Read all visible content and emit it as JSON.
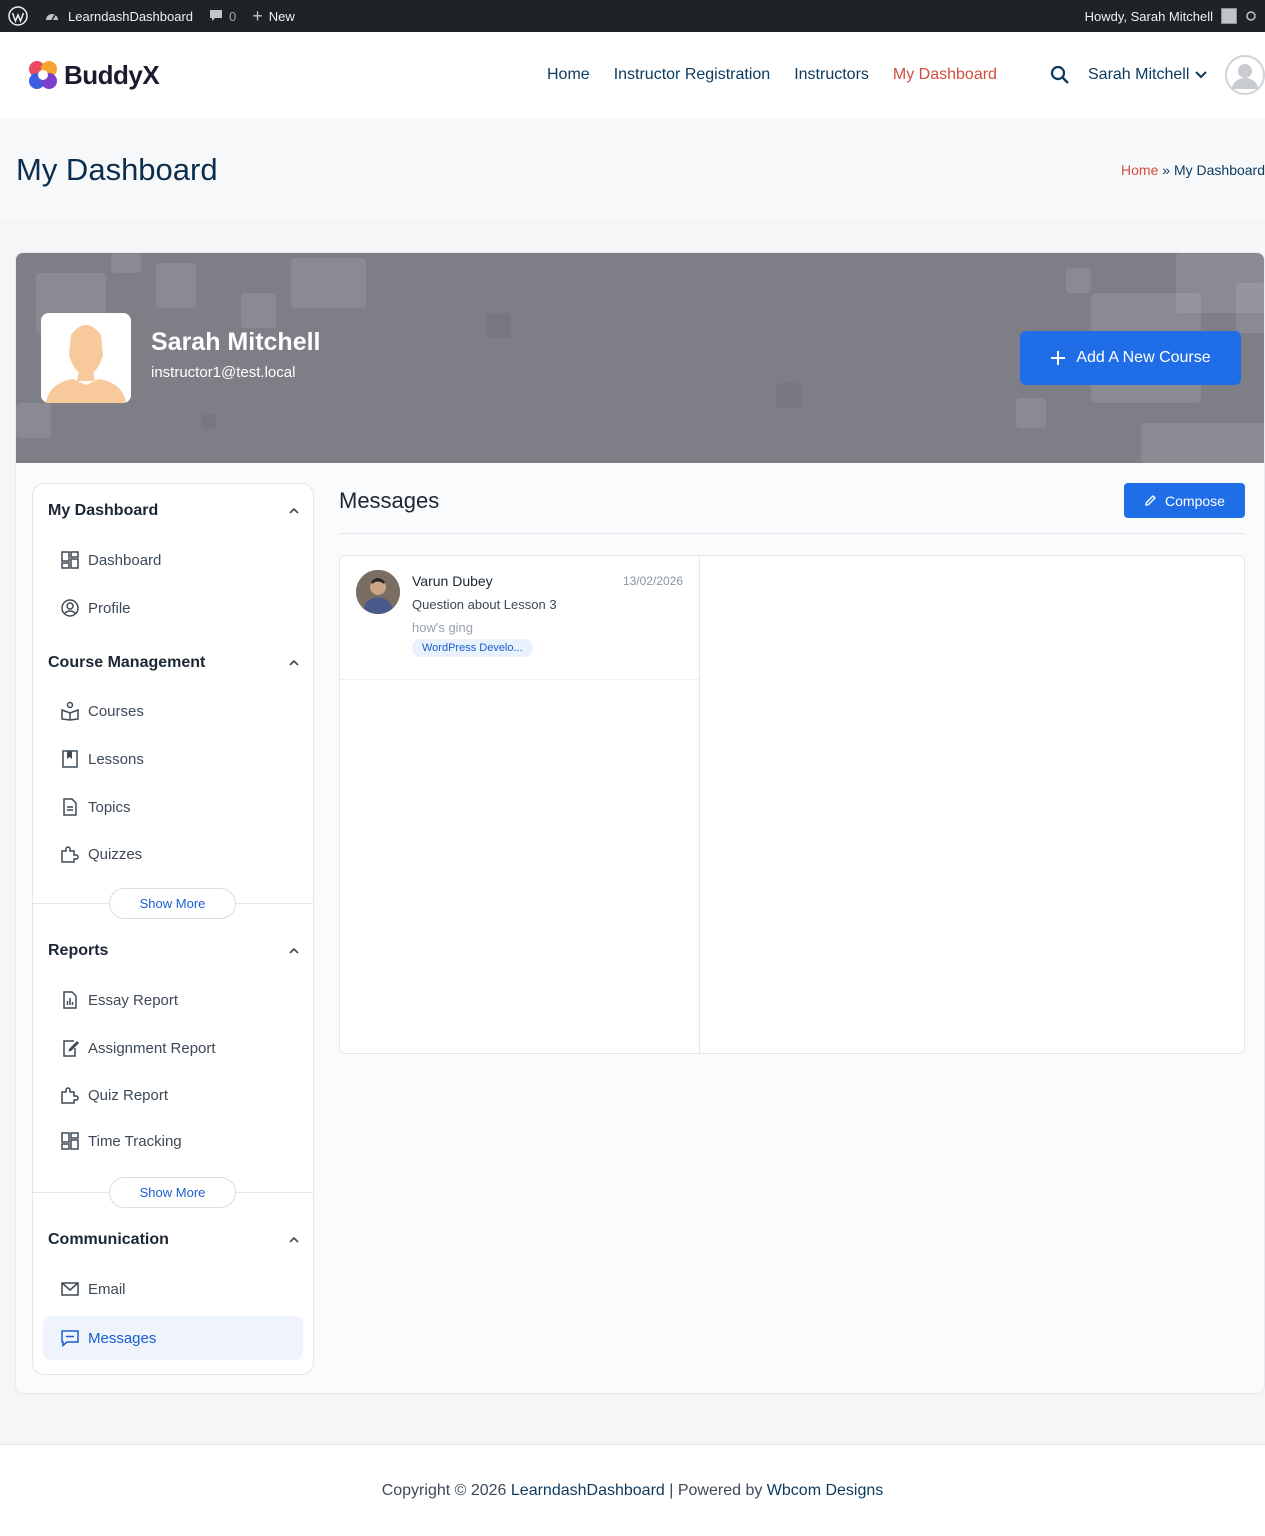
{
  "admin_bar": {
    "site_name": "LearndashDashboard",
    "comments_count": "0",
    "new_label": "New",
    "howdy": "Howdy, Sarah Mitchell"
  },
  "header": {
    "logo_text": "BuddyX",
    "nav": [
      {
        "label": "Home"
      },
      {
        "label": "Instructor Registration"
      },
      {
        "label": "Instructors"
      },
      {
        "label": "My Dashboard"
      }
    ],
    "user_name": "Sarah Mitchell"
  },
  "page": {
    "title": "My Dashboard",
    "breadcrumb_home": "Home",
    "breadcrumb_sep": "»",
    "breadcrumb_current": "My Dashboard"
  },
  "profile": {
    "name": "Sarah Mitchell",
    "email": "instructor1@test.local",
    "add_course_label": "Add A New Course"
  },
  "sidebar": {
    "sections": [
      {
        "title": "My Dashboard",
        "items": [
          "Dashboard",
          "Profile"
        ]
      },
      {
        "title": "Course Management",
        "items": [
          "Courses",
          "Lessons",
          "Topics",
          "Quizzes"
        ],
        "show_more": "Show More"
      },
      {
        "title": "Reports",
        "items": [
          "Essay Report",
          "Assignment Report",
          "Quiz Report",
          "Time Tracking"
        ],
        "show_more": "Show More"
      },
      {
        "title": "Communication",
        "items": [
          "Email",
          "Messages"
        ]
      }
    ]
  },
  "messages": {
    "title": "Messages",
    "compose_label": "Compose",
    "threads": [
      {
        "sender": "Varun Dubey",
        "date": "13/02/2026",
        "subject": "Question about Lesson 3",
        "excerpt": "how's ging",
        "tag": "WordPress Develo..."
      }
    ]
  },
  "footer": {
    "prefix": "Copyright © 2026",
    "site_link": "LearndashDashboard",
    "middle": "| Powered by",
    "powered_link": "Wbcom Designs"
  },
  "colors": {
    "accent": "#1f6ee8",
    "active_nav": "#d24e3f",
    "nav_text": "#0b3a5f",
    "admin_bar": "#1d2327"
  }
}
